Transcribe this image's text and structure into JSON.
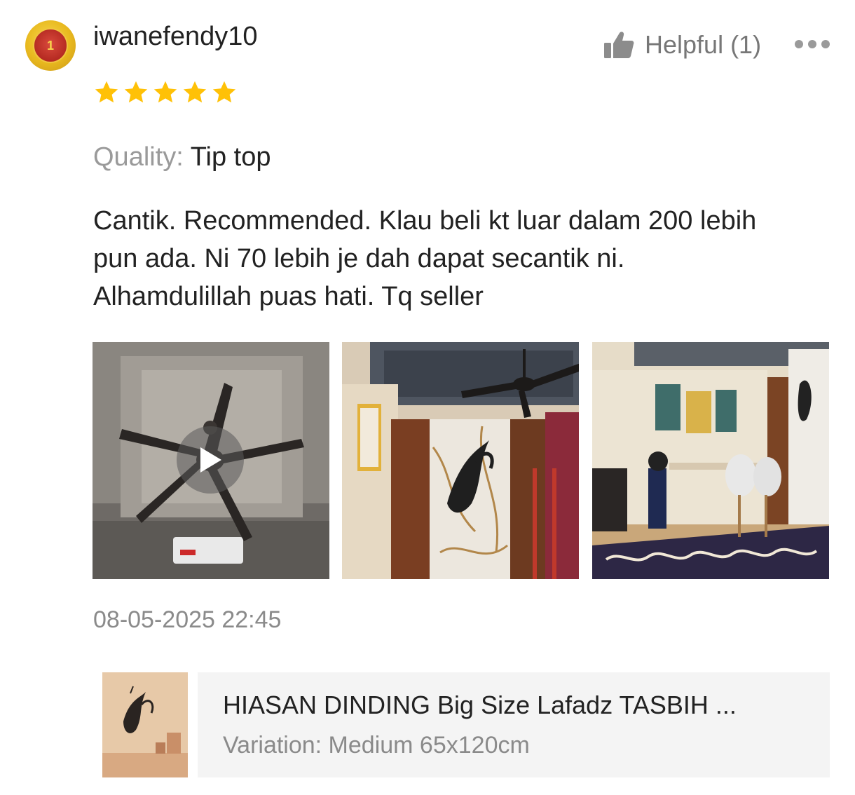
{
  "review": {
    "username": "iwanefendy10",
    "avatar_badge": "1",
    "avatar_icon": "gold-medal-badge",
    "helpful_label": "Helpful (1)",
    "rating": 5,
    "rating_max": 5,
    "quality_label": "Quality:",
    "quality_value": "Tip top",
    "text_lines": [
      "Cantik. Recommended. Klau beli kt luar dalam 200 lebih",
      "pun ada. Ni 70 lebih je dah dapat secantik ni.",
      "Alhamdulillah puas hati. Tq seller"
    ],
    "media": [
      {
        "type": "video",
        "description_icon": "play-icon"
      },
      {
        "type": "photo"
      },
      {
        "type": "photo"
      }
    ],
    "timestamp": "08-05-2025 22:45"
  },
  "product": {
    "name": "HIASAN DINDING Big Size Lafadz TASBIH ...",
    "variation": "Variation: Medium 65x120cm"
  },
  "colors": {
    "star": "#FFC107",
    "muted_text": "#9a9a9a",
    "card_bg": "#f4f4f4"
  }
}
